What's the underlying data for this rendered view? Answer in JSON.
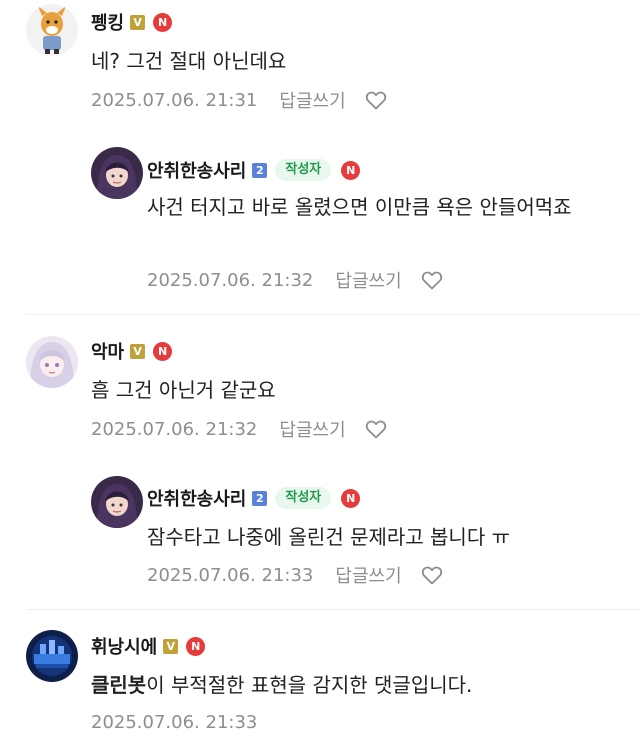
{
  "comments": [
    {
      "nickname": "펭킹",
      "badge_level": "V",
      "badge_new": "N",
      "text": "네? 그건 절대 아닌데요",
      "date": "2025.07.06. 21:31",
      "reply_label": "답글쓰기"
    },
    {
      "nickname": "안취한송사리",
      "badge_level": "2",
      "author_label": "작성자",
      "badge_new": "N",
      "text": "사건 터지고 바로 올렸으면 이만큼 욕은 안들어먹죠",
      "date": "2025.07.06. 21:32",
      "reply_label": "답글쓰기"
    },
    {
      "nickname": "악마",
      "badge_level": "V",
      "badge_new": "N",
      "text": "흠 그건 아닌거 같군요",
      "date": "2025.07.06. 21:32",
      "reply_label": "답글쓰기"
    },
    {
      "nickname": "안취한송사리",
      "badge_level": "2",
      "author_label": "작성자",
      "badge_new": "N",
      "text": "잠수타고 나중에 올린건 문제라고 봅니다 ㅠ",
      "date": "2025.07.06. 21:33",
      "reply_label": "답글쓰기"
    },
    {
      "nickname": "휘낭시에",
      "badge_level": "V",
      "badge_new": "N",
      "text_bold": "클린봇",
      "text_rest": "이 부적절한 표현을 감지한 댓글입니다.",
      "date": "2025.07.06. 21:33"
    }
  ],
  "icons": {
    "like": "heart-outline-icon"
  },
  "colors": {
    "badge_v": "#bfa13a",
    "badge_level2": "#5a82d8",
    "badge_new": "#e63b3b",
    "author_text": "#1f9a4a",
    "author_bg": "#e9f7ee",
    "meta_text": "#8e8e8e"
  }
}
